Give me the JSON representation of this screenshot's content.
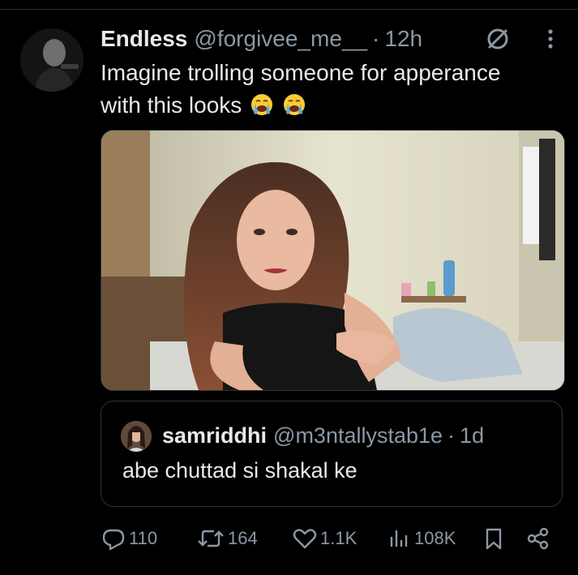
{
  "tweet": {
    "display_name": "Endless",
    "handle": "@forgivee_me__",
    "separator": "·",
    "time": "12h",
    "text_line1": "Imagine trolling someone for apperance",
    "text_line2": "with this looks",
    "emojis": [
      "loudly-crying-face",
      "loudly-crying-face"
    ],
    "avatar_icon": "profile-photo",
    "more_icon": "vertical-ellipsis-icon",
    "mute_icon": "muted-circle-icon"
  },
  "quote": {
    "display_name": "samriddhi",
    "handle": "@m3ntallystab1e",
    "separator": "·",
    "time": "1d",
    "text": "abe chuttad si shakal ke"
  },
  "actions": {
    "replies": "110",
    "reposts": "164",
    "likes": "1.1K",
    "views": "108K"
  },
  "colors": {
    "background": "#000000",
    "text_primary": "#e7e9ea",
    "text_secondary": "#8b98a5",
    "border": "#2f3336",
    "emoji_yellow": "#ffcc33",
    "emoji_tears": "#5aa9e6"
  }
}
